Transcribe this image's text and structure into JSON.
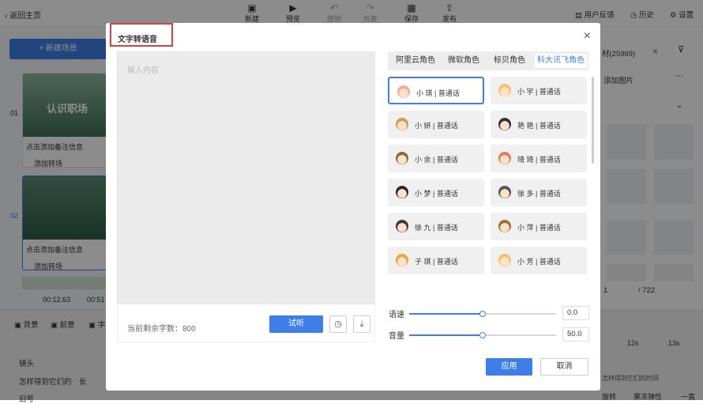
{
  "app": {
    "back_label": "返回主页",
    "toolbar": [
      {
        "label": "新建",
        "icon": "plus-icon"
      },
      {
        "label": "预览",
        "icon": "play-icon"
      },
      {
        "label": "撤销",
        "icon": "undo-icon"
      },
      {
        "label": "恢复",
        "icon": "redo-icon"
      },
      {
        "label": "保存",
        "icon": "save-icon"
      },
      {
        "label": "发布",
        "icon": "publish-icon"
      }
    ],
    "right_links": [
      "用户反馈",
      "历史",
      "设置"
    ],
    "new_scene_label": "+ 新建场景",
    "scenes": [
      {
        "num": "01",
        "note": "点击添加备注信息",
        "transition": "添加转场"
      },
      {
        "num": "02",
        "note": "点击添加备注信息",
        "transition": "添加转场"
      }
    ],
    "thumb1_text": "认识职场",
    "time_current": "00:12.63",
    "time_total": "00:51",
    "bottom_tabs": [
      "背景",
      "前景",
      "字"
    ],
    "tracks": [
      "镜头",
      "怎样得到它们的",
      "旧号"
    ],
    "track_tail": "长",
    "right_search_count": "材(25969)",
    "add_image_label": "添加图片",
    "pager": {
      "current": "1",
      "total": "/ 722"
    },
    "timeline_marks": [
      "12s",
      "13s"
    ],
    "timeline_right_buttons": [
      "旋转",
      "果冻弹性",
      "一直"
    ],
    "timeline_right_text": "怎样得到它们的时间"
  },
  "dialog": {
    "title": "文字转语音",
    "textarea_placeholder": "输入内容",
    "remaining_label": "当前剩余字数：800",
    "listen_label": "试听",
    "tabs": [
      "阿里云角色",
      "微软角色",
      "标贝角色",
      "科大讯飞角色"
    ],
    "active_tab": 3,
    "voices": [
      {
        "name": "小 琪 | 普通话",
        "selected": true,
        "color": "#f4a8a0"
      },
      {
        "name": "小 宇 | 普通话",
        "selected": false,
        "color": "#f3c26a"
      },
      {
        "name": "小 妍 | 普通话",
        "selected": false,
        "color": "#c9a15a"
      },
      {
        "name": "艳 艳 | 普通话",
        "selected": false,
        "color": "#333333"
      },
      {
        "name": "小 余 | 普通话",
        "selected": false,
        "color": "#8a6a3a"
      },
      {
        "name": "琦 琦 | 普通话",
        "selected": false,
        "color": "#e87a5a"
      },
      {
        "name": "小 梦 | 普通话",
        "selected": false,
        "color": "#2a2a2a"
      },
      {
        "name": "徐 多 | 普通话",
        "selected": false,
        "color": "#555555"
      },
      {
        "name": "徐 九 | 普通话",
        "selected": false,
        "color": "#3a3a3a"
      },
      {
        "name": "小 萍 | 普通话",
        "selected": false,
        "color": "#a0703a"
      },
      {
        "name": "子 琪 | 普通话",
        "selected": false,
        "color": "#f0a040"
      },
      {
        "name": "小 芳 | 普通话",
        "selected": false,
        "color": "#f3c26a"
      }
    ],
    "speed_label": "语速",
    "speed_value": "0.0",
    "speed_fraction": 0.5,
    "volume_label": "音量",
    "volume_value": "50.0",
    "volume_fraction": 0.5,
    "apply_label": "应用",
    "cancel_label": "取消"
  }
}
